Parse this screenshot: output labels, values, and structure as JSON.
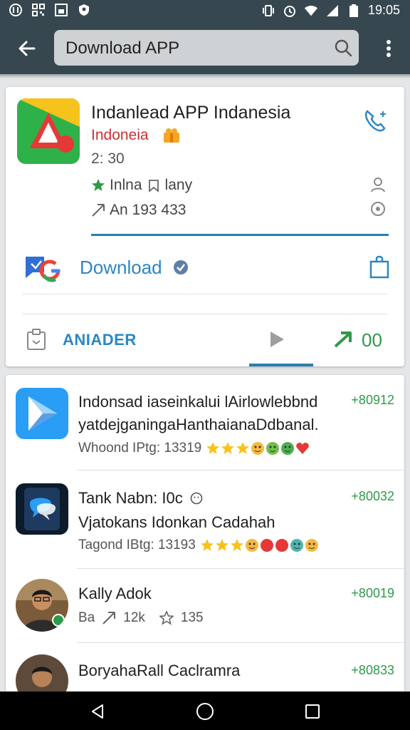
{
  "status_bar": {
    "time": "19:05"
  },
  "app_bar": {
    "search_text": "Download APP"
  },
  "app_card": {
    "title": "Indanlead APP Indanesia",
    "subtitle": "Indoneia",
    "time": "2: 30",
    "meta1_a": "Inlna",
    "meta1_b": "lany",
    "meta2": "An 193 433",
    "download_label": "Download",
    "tab_label": "ANIADER",
    "tab_count": "00"
  },
  "list": {
    "items": [
      {
        "title": "Indonsad iaseinkalui lAirlowlebbnd",
        "subtitle": "yatdejganingaHanthaianaDdbanal.",
        "meta": "Whoond IPtg: 13319",
        "price": "+80912"
      },
      {
        "title": "Tank Nabn: I0c",
        "subtitle": "Vjatokans Idonkan Cadahah",
        "meta": "Tagond IBtg: 13193",
        "price": "+80032"
      },
      {
        "title": "Kally Adok",
        "meta_a": "Ba",
        "meta_b": "12k",
        "meta_c": "135",
        "price": "+80019"
      },
      {
        "title": "BoryahaRall Caclramra",
        "price": "+80833"
      }
    ]
  },
  "colors": {
    "app_bar": "#37474f",
    "accent_blue": "#2b87c4",
    "price_green": "#2e9a48",
    "subtitle_red": "#d32f2f"
  }
}
